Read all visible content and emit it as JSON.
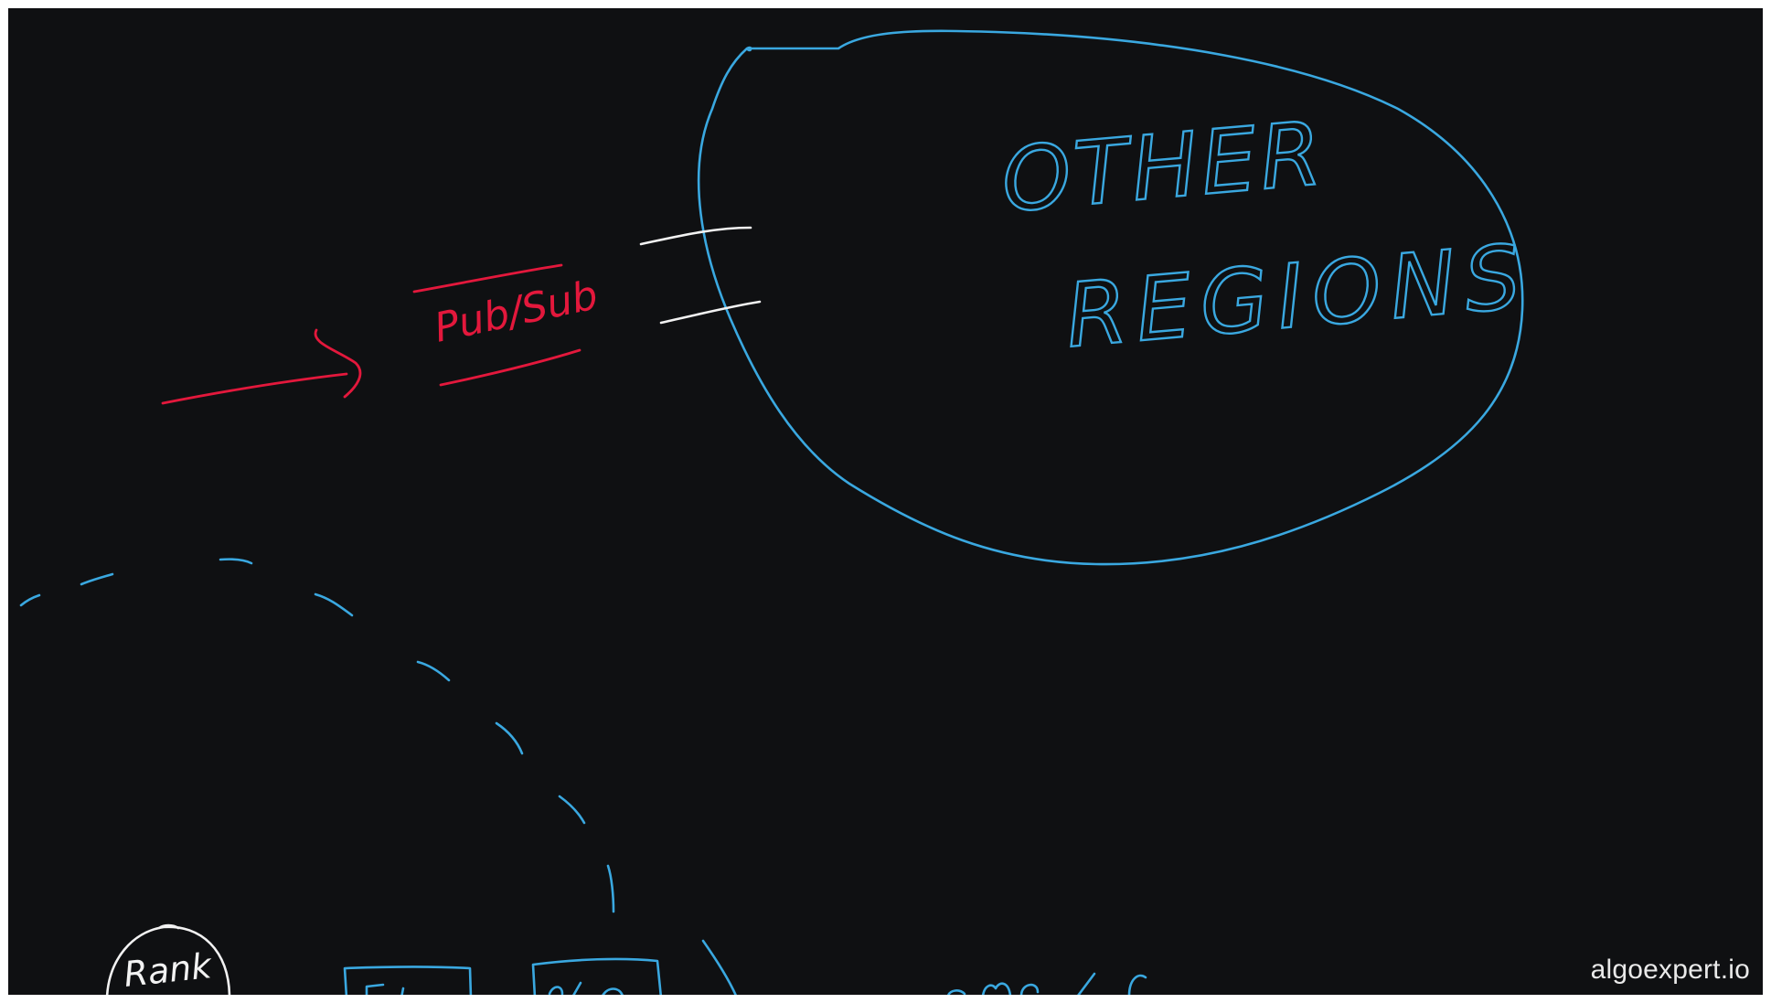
{
  "diagram": {
    "cloud_label_line1": "OTHER",
    "cloud_label_line2": "REGIONS",
    "pubsub_label": "Pub/Sub",
    "rank_label": "Rank"
  },
  "watermark": "algoexpert.io",
  "colors": {
    "background": "#0f1012",
    "blue_ink": "#3aa8e0",
    "red_ink": "#e3183c",
    "white_ink": "#f2f2f2"
  }
}
